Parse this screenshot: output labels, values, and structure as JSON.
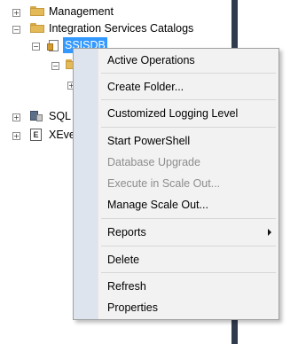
{
  "tree": {
    "management": "Management",
    "integration_services_catalogs": "Integration Services Catalogs",
    "ssisdb": "SSISDB",
    "sql_agent_partial": "SQL",
    "xevent_partial": "XEve"
  },
  "context_menu": {
    "active_operations": "Active Operations",
    "create_folder": "Create Folder...",
    "customized_logging_level": "Customized Logging Level",
    "start_powershell": "Start PowerShell",
    "database_upgrade": "Database Upgrade",
    "execute_in_scale_out": "Execute in Scale Out...",
    "manage_scale_out": "Manage Scale Out...",
    "reports": "Reports",
    "delete": "Delete",
    "refresh": "Refresh",
    "properties": "Properties"
  },
  "colors": {
    "selection": "#3399ff",
    "menu_background": "#f2f2f2",
    "menu_gutter": "#dde4ee",
    "disabled_text": "#8d8d8d",
    "dark_panel": "#2f3c4d"
  }
}
